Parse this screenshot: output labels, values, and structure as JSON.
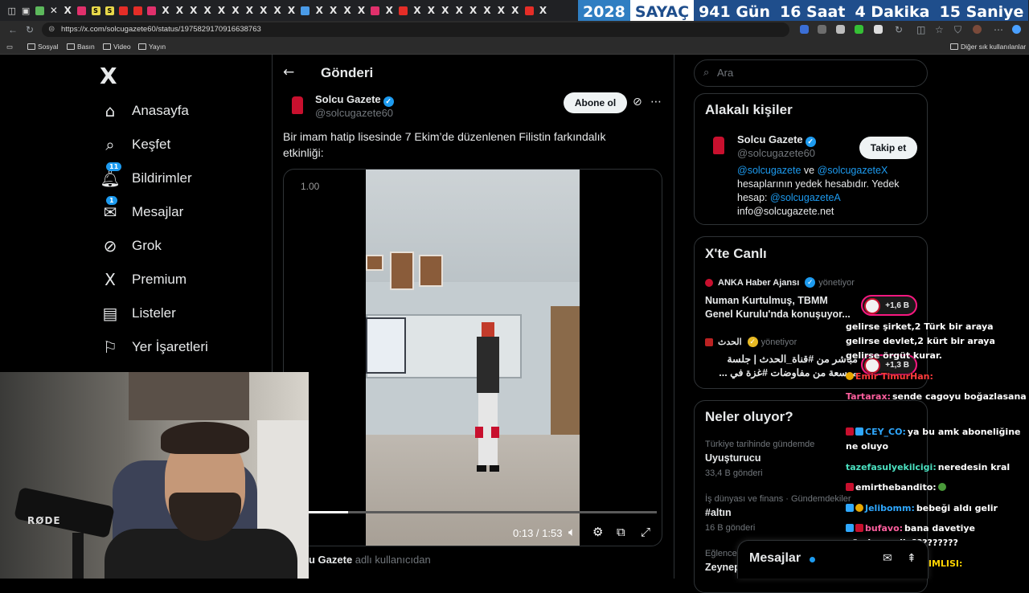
{
  "browser": {
    "url": "https://x.com/solcugazete60/status/1975829170916638763",
    "bookmarks": [
      "Sosyal",
      "Basın",
      "Video",
      "Yayın"
    ],
    "other_bookmarks": "Diğer sık kullanılanlar"
  },
  "countdown": {
    "year": "2028",
    "label": "SAYAÇ",
    "days": "941 Gün",
    "hours": "16 Saat",
    "minutes": "4  Dakika",
    "seconds": "15 Saniye"
  },
  "nav": {
    "logo": "X",
    "items": [
      {
        "label": "Anasayfa",
        "icon": "home-icon",
        "glyph": "⌂"
      },
      {
        "label": "Keşfet",
        "icon": "search-icon",
        "glyph": "⌕"
      },
      {
        "label": "Bildirimler",
        "icon": "bell-icon",
        "glyph": "🔔︎",
        "badge": "11"
      },
      {
        "label": "Mesajlar",
        "icon": "envelope-icon",
        "glyph": "✉",
        "badge": "1"
      },
      {
        "label": "Grok",
        "icon": "grok-icon",
        "glyph": "⊘"
      },
      {
        "label": "Premium",
        "icon": "x-premium-icon",
        "glyph": "X"
      },
      {
        "label": "Listeler",
        "icon": "list-icon",
        "glyph": "▤"
      },
      {
        "label": "Yer İşaretleri",
        "icon": "bookmark-icon",
        "glyph": "⚐"
      }
    ]
  },
  "post": {
    "header": "Gönderi",
    "author_name": "Solcu Gazete",
    "author_handle": "@solcugazete60",
    "subscribe_label": "Abone ol",
    "text": "Bir imam hatip lisesinde 7 Ekim’de düzenlenen Filistin farkındalık etkinliği:",
    "video": {
      "speed": "1.00",
      "time": "0:13 / 1:53",
      "progress": 0.115
    },
    "attribution_name": "u Gazete",
    "attribution_suffix": " adlı kullanıcıdan"
  },
  "sidebar": {
    "search_placeholder": "Ara",
    "related": {
      "title": "Alakalı kişiler",
      "name": "Solcu Gazete",
      "handle": "@solcugazete60",
      "follow_label": "Takip et",
      "bio_link1": "@solcugazete",
      "bio_mid": " ve ",
      "bio_link2": "@solcugazeteX",
      "bio_text": " hesaplarının yedek hesabıdır. Yedek hesap: ",
      "bio_link3": "@solcugazeteA",
      "bio_email": "info@solcugazete.net"
    },
    "live": {
      "title": "X'te Canlı",
      "items": [
        {
          "source": "ANKA Haber Ajansı",
          "status": "yönetiyor",
          "text": "Numan Kurtulmuş, TBMM Genel Kurulu'nda konuşuyor...",
          "count": "+1,6 B"
        },
        {
          "source": "الحدث",
          "status": "yönetiyor",
          "text": "مباشر من #قناة_الحدث | جلسة موسعة من مفاوضات #غزة في ...",
          "count": "+1,3 B"
        }
      ]
    },
    "trends": {
      "title": "Neler oluyor?",
      "items": [
        {
          "category": "Türkiye tarihinde gündemde",
          "name": "Uyuşturucu",
          "count": "33,4 B gönderi"
        },
        {
          "category": "İş dünyası ve finans · Gündemdekiler",
          "name": "#altın",
          "count": "16 B gönderi"
        },
        {
          "category": "Eğlence",
          "name": "Zeynep",
          "count": ""
        }
      ]
    }
  },
  "messages_dock": {
    "label": "Mesajlar"
  },
  "chat": [
    {
      "user": "",
      "msg": "gelirse şirket,2 Türk bir araya gelirse devlet,2 kürt bir araya gelirse örgüt kurar.",
      "color": "#ffffff"
    },
    {
      "user": "Emir TimurHan:",
      "msg": "",
      "color": "#ff3b3b"
    },
    {
      "user": "Tartarax:",
      "msg": "sende cagoyu boğazlasana",
      "color": "#ff5f9e"
    },
    {
      "user": "CEY_CO:",
      "msg": "ya bu amk aboneliğine ne oluyo",
      "color": "#2fa8ff"
    },
    {
      "user": "tazefasulyekilcigi:",
      "msg": "neredesin kral",
      "color": "#4be0c0"
    },
    {
      "user": "emirthebandito:",
      "msg": "",
      "color": "#ffffff"
    },
    {
      "user": "Jelibomm:",
      "msg": "bebeği aldı gelir",
      "color": "#2fa8ff"
    },
    {
      "user": "bufavo:",
      "msg": "bana davetiye göndermedin?????????",
      "color": "#ff5f9e"
    },
    {
      "user": "APOSIKMEBAGIMLISI:",
      "msg": "",
      "color": "#ffd400"
    }
  ],
  "webcam": {
    "mic_brand": "RØDE"
  }
}
